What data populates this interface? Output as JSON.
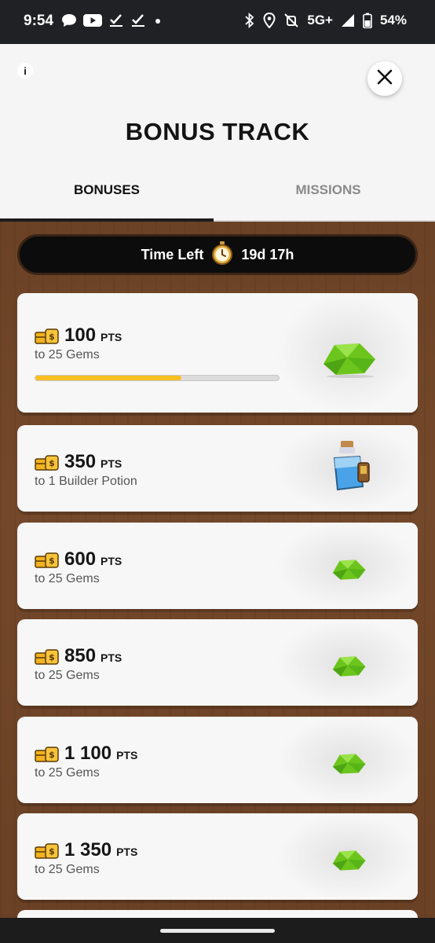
{
  "status_bar": {
    "time": "9:54",
    "network": "5G+",
    "battery": "54%",
    "icons": [
      "messages-icon",
      "youtube-icon",
      "check-icon",
      "check-icon",
      "dot-icon",
      "bluetooth-icon",
      "location-icon",
      "mute-icon",
      "signal-icon",
      "battery-icon"
    ]
  },
  "header": {
    "info_label": "i",
    "title": "BONUS TRACK"
  },
  "tabs": [
    {
      "label": "BONUSES",
      "active": true
    },
    {
      "label": "MISSIONS",
      "active": false
    }
  ],
  "timer": {
    "label": "Time Left",
    "value": "19d 17h",
    "icon": "stopwatch-icon"
  },
  "bonuses": [
    {
      "points": "100",
      "unit": "PTS",
      "reward": "to 25 Gems",
      "icon": "gem-icon",
      "progress": 0.6
    },
    {
      "points": "350",
      "unit": "PTS",
      "reward": "to 1 Builder Potion",
      "icon": "potion-icon"
    },
    {
      "points": "600",
      "unit": "PTS",
      "reward": "to 25 Gems",
      "icon": "gem-icon"
    },
    {
      "points": "850",
      "unit": "PTS",
      "reward": "to 25 Gems",
      "icon": "gem-icon"
    },
    {
      "points": "1 100",
      "unit": "PTS",
      "reward": "to 25 Gems",
      "icon": "gem-icon"
    },
    {
      "points": "1 350",
      "unit": "PTS",
      "reward": "to 25 Gems",
      "icon": "gem-icon"
    }
  ],
  "colors": {
    "progress": "#fbbf24",
    "gem": "#6cc51c",
    "coin": "#f0b21f",
    "wood": "#6b4226"
  }
}
